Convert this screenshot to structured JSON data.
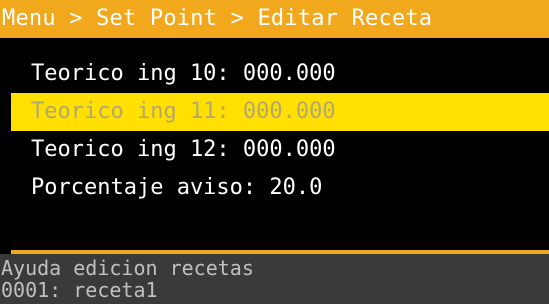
{
  "header": {
    "breadcrumb": "Menu > Set Point > Editar Receta"
  },
  "menu": {
    "items": [
      {
        "label": "Teorico ing 10: 000.000",
        "selected": false
      },
      {
        "label": "Teorico ing 11: 000.000",
        "selected": true
      },
      {
        "label": "Teorico ing 12: 000.000",
        "selected": false
      },
      {
        "label": "Porcentaje aviso: 20.0",
        "selected": false
      }
    ]
  },
  "help": {
    "title": "Ayuda edicion recetas",
    "recipe": "0001: receta1"
  },
  "colors": {
    "accent": "#f2a81d",
    "selection": "#ffe000",
    "background": "#000000",
    "help_background": "#3a3a3a"
  }
}
